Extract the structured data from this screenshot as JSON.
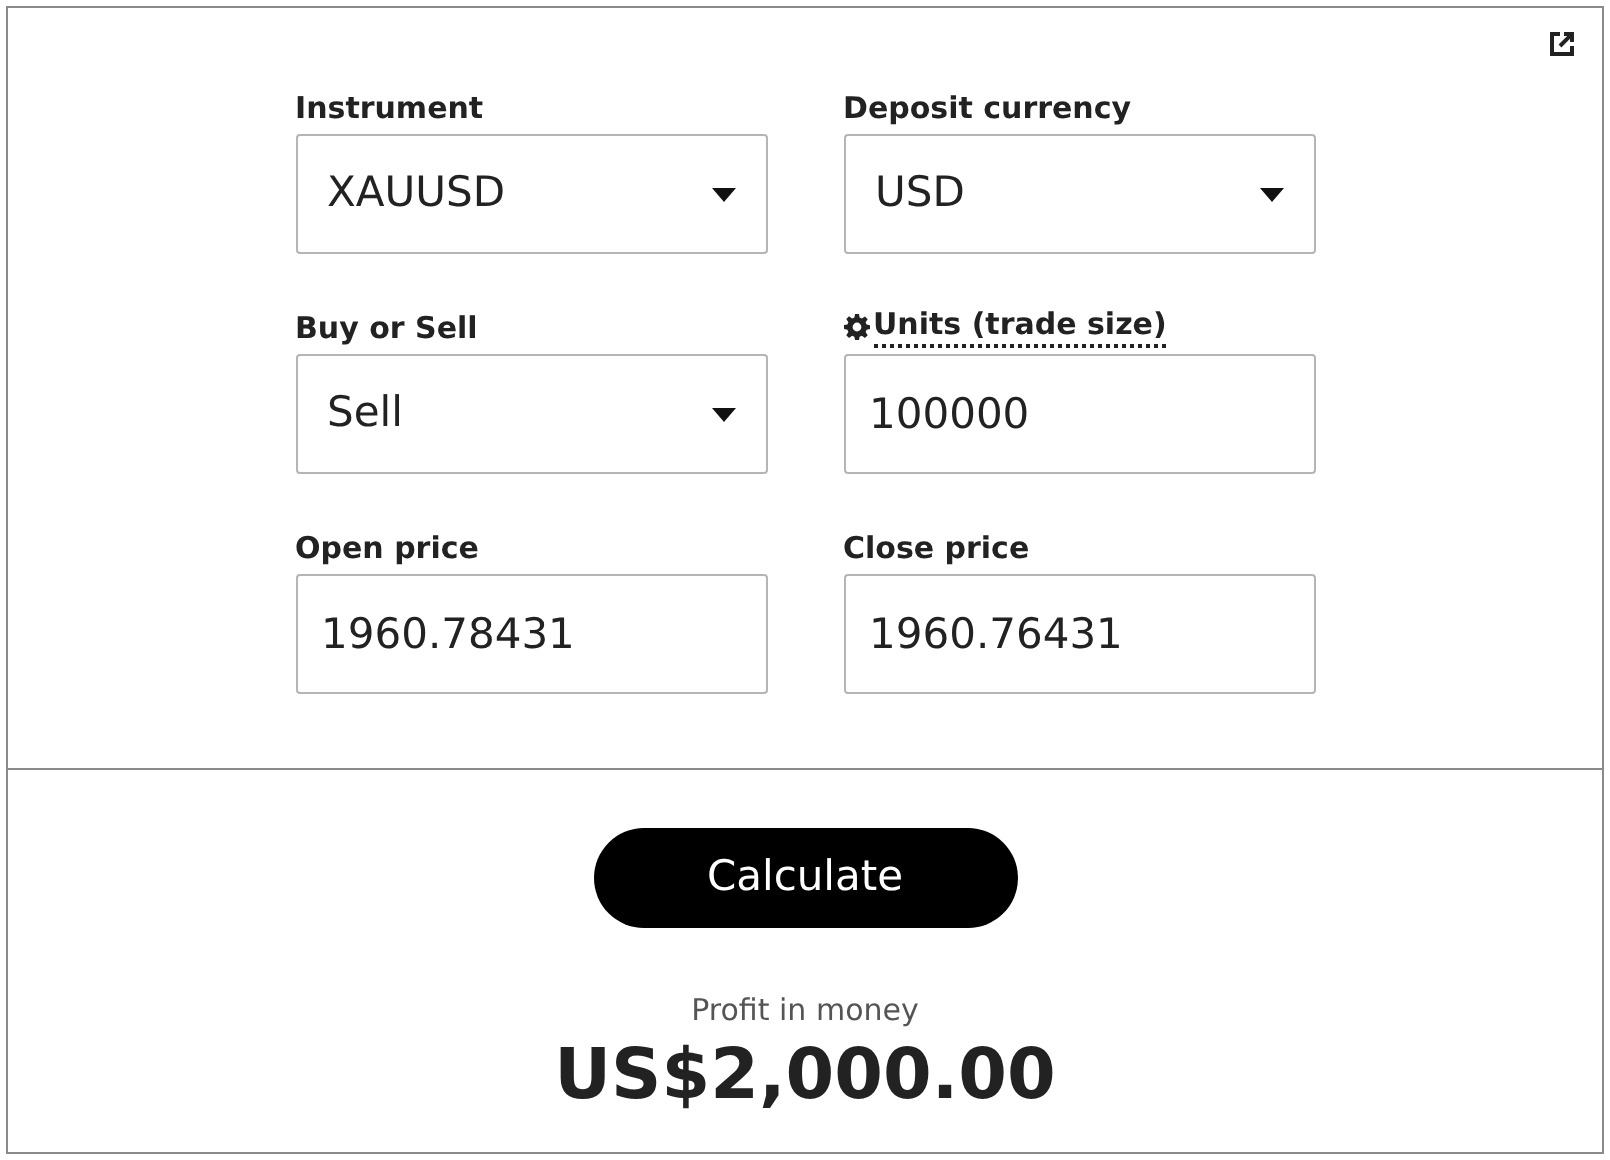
{
  "fields": [
    {
      "label": "Instrument",
      "kind": "select",
      "value": "XAUUSD",
      "info": false
    },
    {
      "label": "Deposit currency",
      "kind": "select",
      "value": "USD",
      "info": false
    },
    {
      "label": "Buy or Sell",
      "kind": "select",
      "value": "Sell",
      "info": false
    },
    {
      "label": "Units (trade size)",
      "kind": "input",
      "value": "100000",
      "info": true
    },
    {
      "label": "Open price",
      "kind": "input",
      "value": "1960.78431",
      "info": false
    },
    {
      "label": "Close price",
      "kind": "input",
      "value": "1960.76431",
      "info": false
    }
  ],
  "button": "Calculate",
  "result": {
    "label": "Profit in money",
    "value": "US$2,000.00"
  }
}
